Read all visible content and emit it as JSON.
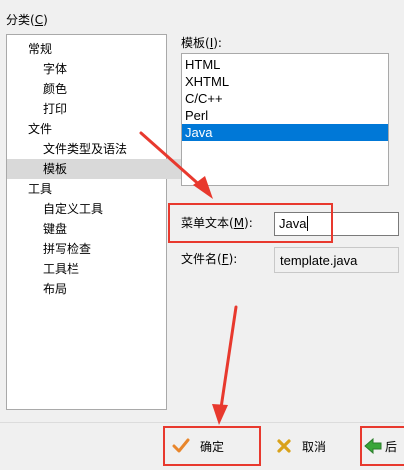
{
  "category": {
    "label": "分类(",
    "hotkey": "C",
    "label_end": ")"
  },
  "tree": {
    "items": [
      {
        "label": "常规",
        "level": 0
      },
      {
        "label": "字体",
        "level": 1
      },
      {
        "label": "颜色",
        "level": 1
      },
      {
        "label": "打印",
        "level": 1
      },
      {
        "label": "文件",
        "level": 0
      },
      {
        "label": "文件类型及语法",
        "level": 1
      },
      {
        "label": "模板",
        "level": 1,
        "selected": true
      },
      {
        "label": "工具",
        "level": 0
      },
      {
        "label": "自定义工具",
        "level": 1
      },
      {
        "label": "键盘",
        "level": 1
      },
      {
        "label": "拼写检查",
        "level": 1
      },
      {
        "label": "工具栏",
        "level": 1
      },
      {
        "label": "布局",
        "level": 1
      }
    ]
  },
  "templates": {
    "label": "模板(",
    "hotkey": "I",
    "label_end": "):",
    "items": [
      "HTML",
      "XHTML",
      "C/C++",
      "Perl",
      "Java"
    ],
    "selected": "Java"
  },
  "menu_text": {
    "label": "菜单文本(",
    "hotkey": "M",
    "label_end": "):",
    "value": "Java"
  },
  "file_name": {
    "label": "文件名(",
    "hotkey": "F",
    "label_end": "):",
    "value": "template.java"
  },
  "buttons": {
    "ok": "确定",
    "cancel": "取消",
    "back": "后"
  },
  "colors": {
    "selection_blue": "#0078d7",
    "annotation_red": "#e8392e",
    "ok_check_orange": "#e8862c",
    "cancel_x_gold": "#d9a21b",
    "back_arrow_green": "#3aa63a"
  },
  "icons": {
    "ok": "checkmark-icon",
    "cancel": "x-icon",
    "back": "back-arrow-icon"
  }
}
